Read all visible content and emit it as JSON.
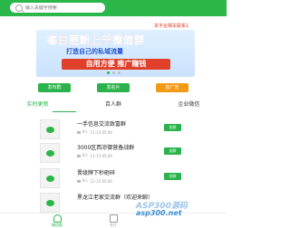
{
  "search": {
    "placeholder": "输入关键字搜索"
  },
  "notice": "本平台相关联系1",
  "banner": {
    "headline": "每日更新上千微信群",
    "subline": "打造自己的私域流量",
    "cta": "自用方便  推广赚钱",
    "dots": 3
  },
  "actions": [
    {
      "label": "发布群",
      "color": "#29b34a"
    },
    {
      "label": "发名片",
      "color": "#29b34a"
    },
    {
      "label": "加广告",
      "color": "#f29a14"
    }
  ],
  "tabs": [
    {
      "label": "实时更新",
      "active": true
    },
    {
      "label": "百人群",
      "active": false
    },
    {
      "label": "企业微信",
      "active": false
    }
  ],
  "items": [
    {
      "title": "一手信息交流致富群",
      "views": "8人",
      "date": "11-13 05:00",
      "button": "加群"
    },
    {
      "title": "3000区西凉御营备战群",
      "views": "8人",
      "date": "11-13 05:00",
      "button": "加群"
    },
    {
      "title": "晋级牌下秒砸碎",
      "views": "8人",
      "date": "11-13 05:00",
      "button": "加群"
    },
    {
      "title": "黑龙江老家交流群（欢迎来聊）",
      "views": "",
      "date": "",
      "button": ""
    }
  ],
  "nav": [
    {
      "label": "微信群",
      "icon": "home-icon",
      "active": true
    },
    {
      "label": "名片",
      "icon": "card-icon",
      "active": false
    }
  ],
  "watermark": {
    "line1": "ASP300源码",
    "line2": "asp300.net"
  },
  "colors": {
    "brand": "#2bb64a",
    "accent": "#e23a2a",
    "orange": "#f29a14"
  }
}
